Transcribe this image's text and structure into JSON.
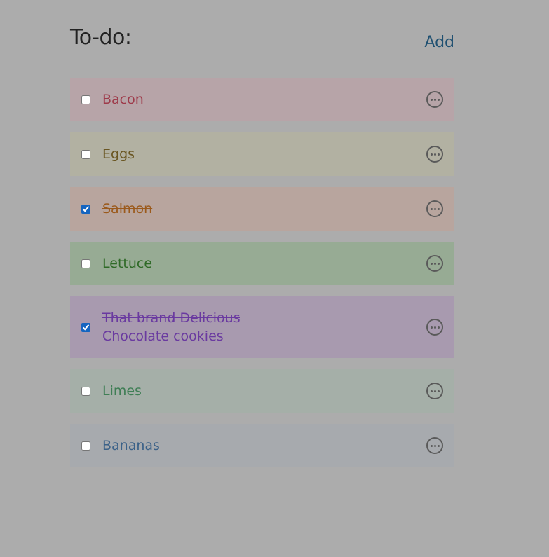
{
  "header": {
    "title": "To-do:",
    "add_label": "Add"
  },
  "items": [
    {
      "label": "Bacon",
      "checked": false,
      "bg": "#b7a4a8",
      "fg": "#9e3a4a"
    },
    {
      "label": "Eggs",
      "checked": false,
      "bg": "#b2b1a2",
      "fg": "#6a5622"
    },
    {
      "label": "Salmon",
      "checked": true,
      "bg": "#b8a59e",
      "fg": "#9b5a1c"
    },
    {
      "label": "Lettuce",
      "checked": false,
      "bg": "#97ab94",
      "fg": "#2f6a27"
    },
    {
      "label": "That brand Delicious Chocolate cookies",
      "checked": true,
      "bg": "#a89aaf",
      "fg": "#6a3aa0"
    },
    {
      "label": "Limes",
      "checked": false,
      "bg": "#a5afa8",
      "fg": "#3f7e55"
    },
    {
      "label": "Bananas",
      "checked": false,
      "bg": "#a7aaae",
      "fg": "#3b6188"
    }
  ],
  "icons": {
    "more": "more-options-icon"
  }
}
